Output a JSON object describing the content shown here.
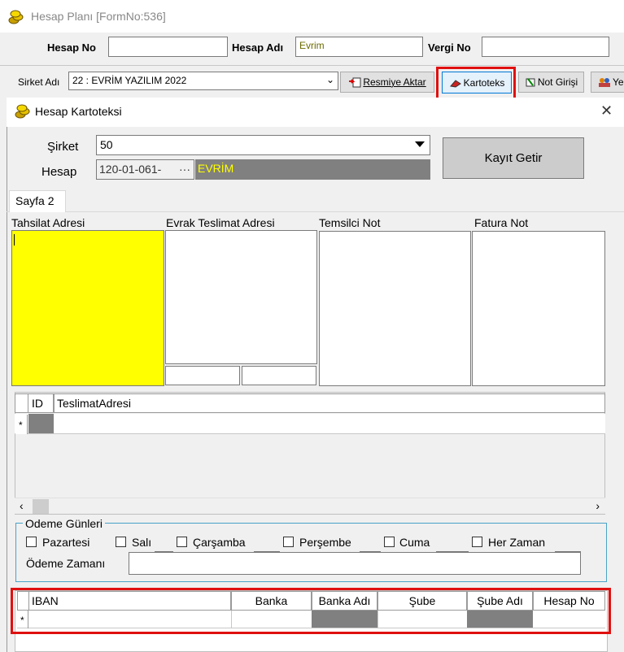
{
  "window": {
    "title": "Hesap Planı [FormNo:536]"
  },
  "toprow": {
    "hesap_no_label": "Hesap No",
    "hesap_no_value": "",
    "hesap_adi_label": "Hesap Adı",
    "hesap_adi_value": "Evrim",
    "vergi_no_label": "Vergi No",
    "vergi_no_value": ""
  },
  "toolbar": {
    "sirket_label": "Sirket Adı",
    "sirket_value": "22 : EVRİM YAZILIM  2022",
    "resmiye_label": "Resmiye Aktar",
    "kartoteks_label": "Kartoteks",
    "not_label": "Not Girişi",
    "ye_label": "Ye"
  },
  "dialog": {
    "title": "Hesap Kartoteksi",
    "close": "✕",
    "sirket_label": "Şirket",
    "sirket_value": "50",
    "hesap_label": "Hesap",
    "hesap_code": "120-01-061-",
    "hesap_dots": "···",
    "hesap_name": "EVRİM",
    "kayit_button": "Kayıt Getir",
    "tab": "Sayfa 2",
    "panels": {
      "tahsilat": "Tahsilat Adresi",
      "evrak": "Evrak Teslimat Adresi",
      "temsilci": "Temsilci Not",
      "fatura": "Fatura Not"
    },
    "grid1": {
      "col_id": "ID",
      "col_addr": "TeslimatAdresi",
      "new_row": "*"
    },
    "odeme": {
      "legend": "Odeme Günleri",
      "days": [
        "Pazartesi",
        "Salı",
        "Çarşamba",
        "Perşembe",
        "Cuma",
        "Her Zaman"
      ],
      "zaman_label": "Ödeme Zamanı",
      "zaman_value": ""
    },
    "grid2": {
      "cols": [
        "IBAN",
        "Banka",
        "Banka Adı",
        "Şube",
        "Şube Adı",
        "Hesap No"
      ],
      "new_row": "*"
    }
  },
  "colors": {
    "highlight": "#ffff00",
    "name_text": "#ffff00",
    "dark_cell": "#808080",
    "red": "#e01010"
  }
}
